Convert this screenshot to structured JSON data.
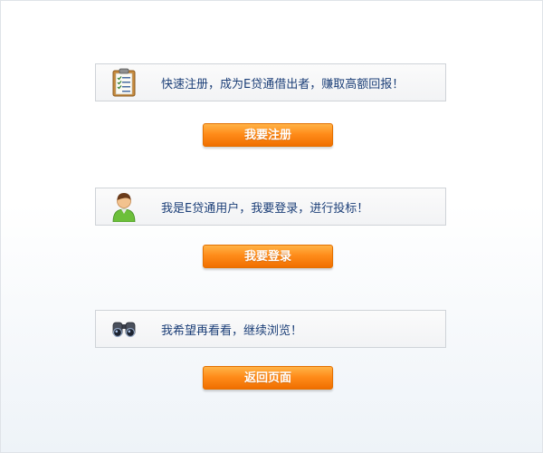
{
  "sections": [
    {
      "icon": "clipboard-icon",
      "message": "快速注册，成为E贷通借出者，赚取高额回报！",
      "button_label": "我要注册"
    },
    {
      "icon": "user-icon",
      "message": "我是E贷通用户，我要登录，进行投标！",
      "button_label": "我要登录"
    },
    {
      "icon": "binoculars-icon",
      "message": "我希望再看看，继续浏览！",
      "button_label": "返回页面"
    }
  ],
  "colors": {
    "text": "#1c3f78",
    "button_top": "#ffb347",
    "button_bottom": "#f06f00"
  }
}
